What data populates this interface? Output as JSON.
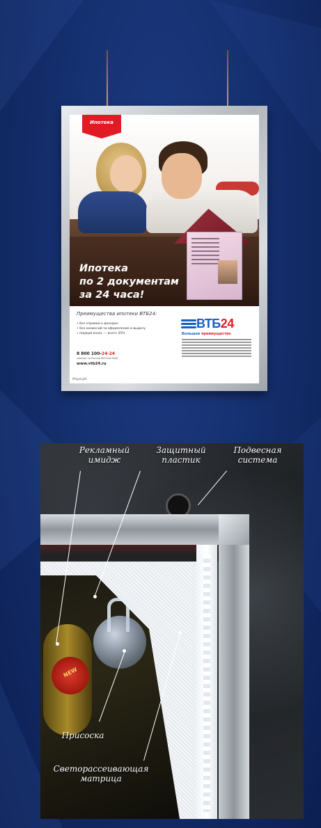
{
  "poster": {
    "tag": "Ипотека",
    "headline": "Ипотека\nпо 2 документам\nза 24 часа!",
    "advantages_title": "Преимущества ипотеки ВТБ24:",
    "bullets": [
      "• без справки о доходах",
      "• без комиссий за оформление и выдачу",
      "• первый взнос — всего 35%"
    ],
    "phone_prefix": "8 800 100-",
    "phone_suffix": "24-24",
    "phone_note": "(звонок по России бесплатный)",
    "site": "www.vtb24.ru",
    "logo_main": "ВТБ",
    "logo_num": "24",
    "slogan_a": "Большое ",
    "slogan_b": "преимущество",
    "frame_brand": "MegaLight"
  },
  "callouts": {
    "image": "Рекламный\nимидж",
    "plastic": "Защитный\nпластик",
    "hanging": "Подвесная\nсистема",
    "sucker": "Присоска",
    "matrix": "Светорассеивающая\nматрица"
  },
  "seal_text": "NEW"
}
